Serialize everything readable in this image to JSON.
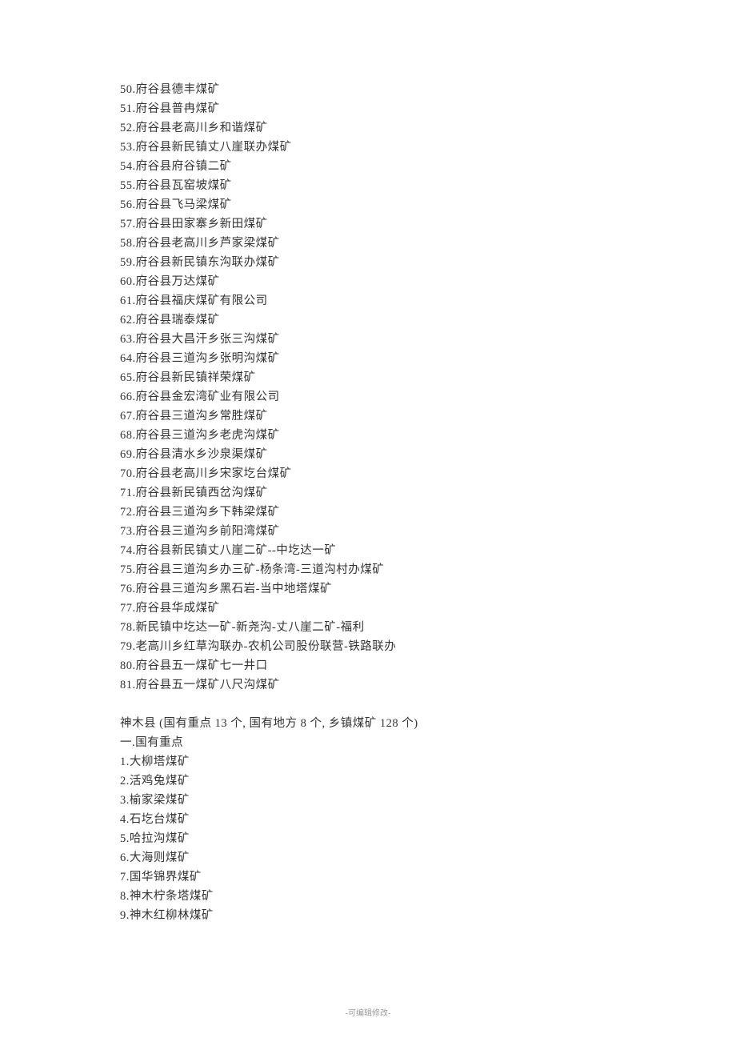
{
  "fugu_items": [
    "50.府谷县德丰煤矿",
    "51.府谷县普冉煤矿",
    "52.府谷县老高川乡和谐煤矿",
    "53.府谷县新民镇丈八崖联办煤矿",
    "54.府谷县府谷镇二矿",
    "55.府谷县瓦窑坡煤矿",
    "56.府谷县飞马梁煤矿",
    "57.府谷县田家寨乡新田煤矿",
    "58.府谷县老高川乡芦家梁煤矿",
    "59.府谷县新民镇东沟联办煤矿",
    "60.府谷县万达煤矿",
    "61.府谷县福庆煤矿有限公司",
    "62.府谷县瑞泰煤矿",
    "63.府谷县大昌汗乡张三沟煤矿",
    "64.府谷县三道沟乡张明沟煤矿",
    "65.府谷县新民镇祥荣煤矿",
    "66.府谷县金宏湾矿业有限公司",
    "67.府谷县三道沟乡常胜煤矿",
    "68.府谷县三道沟乡老虎沟煤矿",
    "69.府谷县清水乡沙泉渠煤矿",
    "70.府谷县老高川乡宋家圪台煤矿",
    "71.府谷县新民镇西岔沟煤矿",
    "72.府谷县三道沟乡下韩梁煤矿",
    "73.府谷县三道沟乡前阳湾煤矿",
    "74.府谷县新民镇丈八崖二矿--中圪达一矿",
    "75.府谷县三道沟乡办三矿-杨条湾-三道沟村办煤矿",
    "76.府谷县三道沟乡黑石岩-当中地塔煤矿",
    "77.府谷县华成煤矿",
    "78.新民镇中圪达一矿-新尧沟-丈八崖二矿-福利",
    "79.老高川乡红草沟联办-农机公司股份联营-铁路联办",
    "80.府谷县五一煤矿七一井口",
    "81.府谷县五一煤矿八尺沟煤矿"
  ],
  "shenmu_header": "神木县 (国有重点 13 个, 国有地方 8 个, 乡镇煤矿 128 个)",
  "shenmu_section_title": "一.国有重点",
  "shenmu_items": [
    "1.大柳塔煤矿",
    "2.活鸡兔煤矿",
    "3.榆家梁煤矿",
    "4.石圪台煤矿",
    "5.哈拉沟煤矿",
    "6.大海则煤矿",
    "7.国华锦界煤矿",
    "8.神木柠条塔煤矿",
    "9.神木红柳林煤矿"
  ],
  "footer": "-可编辑修改-"
}
